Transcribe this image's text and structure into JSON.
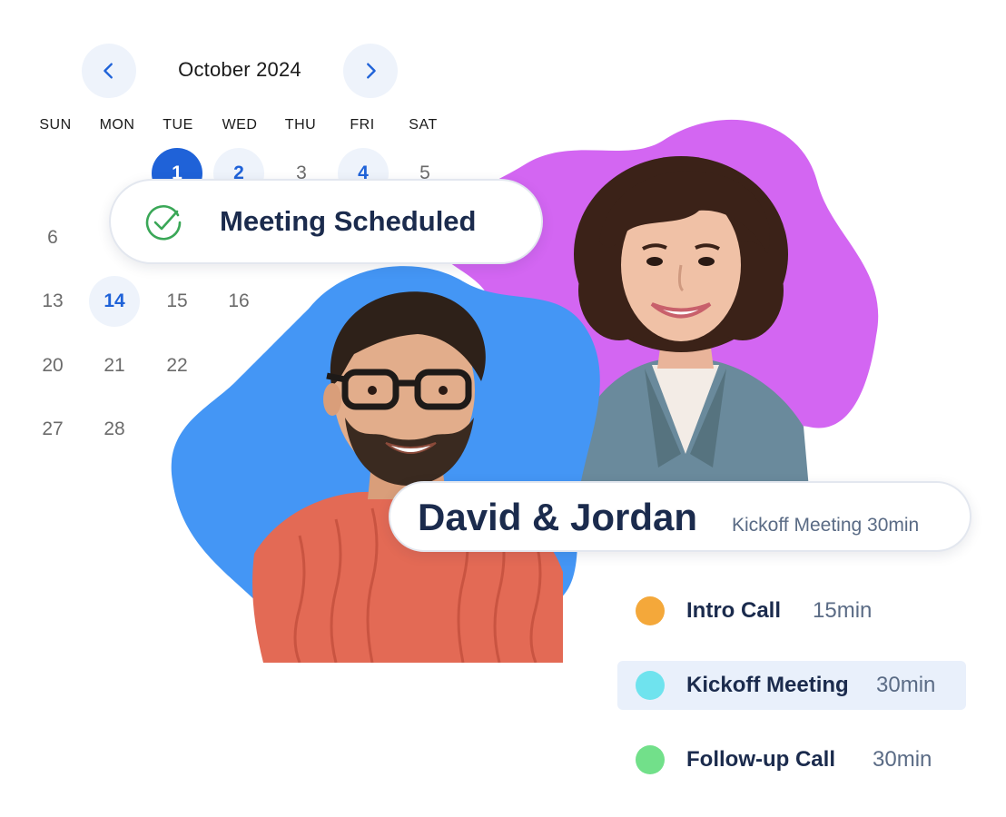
{
  "calendar": {
    "month_title": "October 2024",
    "prev_icon": "chevron-left-icon",
    "next_icon": "chevron-right-icon",
    "accent_color": "#1f62d8",
    "weekdays": [
      "SUN",
      "MON",
      "TUE",
      "WED",
      "THU",
      "FRI",
      "SAT"
    ],
    "days": {
      "d1": "1",
      "d2": "2",
      "d3": "3",
      "d4": "4",
      "d5": "5",
      "d6": "6",
      "d13": "13",
      "d14": "14",
      "d15": "15",
      "d16": "16",
      "d20": "20",
      "d21": "21",
      "d22": "22",
      "d27": "27",
      "d28": "28"
    },
    "selected_day": "1",
    "available_days": [
      "2",
      "4",
      "14"
    ]
  },
  "notification": {
    "icon": "check-circle-icon",
    "label": "Meeting Scheduled",
    "icon_color": "#3aa757"
  },
  "meeting": {
    "names": "David & Jordan",
    "subtitle": "Kickoff Meeting 30min"
  },
  "event_types": [
    {
      "name": "Intro Call",
      "duration": "15min",
      "color": "#f4a83a",
      "active": false
    },
    {
      "name": "Kickoff Meeting",
      "duration": "30min",
      "color": "#6fe3ee",
      "active": true
    },
    {
      "name": "Follow-up Call",
      "duration": "30min",
      "color": "#72e08a",
      "active": false
    }
  ],
  "colors": {
    "blob_purple": "#d366f2",
    "blob_blue": "#4496f5",
    "text_dark": "#1b2b4d"
  }
}
